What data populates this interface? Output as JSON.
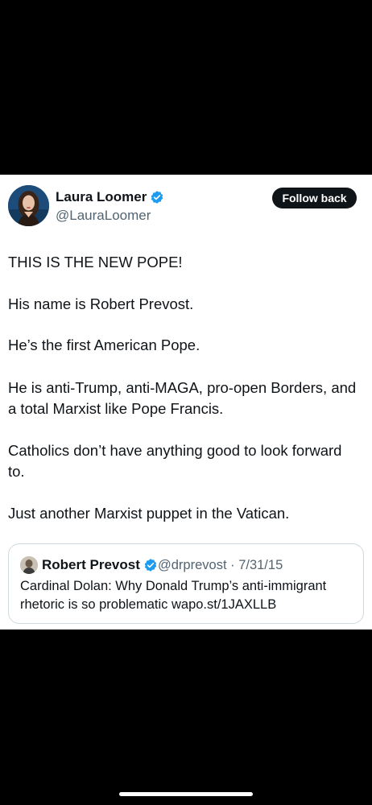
{
  "tweet": {
    "author": {
      "display_name": "Laura Loomer",
      "handle": "@LauraLoomer",
      "verified": true,
      "avatar_icon": "profile-photo"
    },
    "follow_button_label": "Follow back",
    "paragraphs": [
      "THIS IS THE NEW POPE!",
      "His name is Robert Prevost.",
      "He’s the first American Pope.",
      "He is anti-Trump, anti-MAGA, pro-open Borders, and a total Marxist like Pope Francis.",
      "Catholics don’t have anything good to look forward to.",
      "Just another Marxist puppet in the Vatican."
    ],
    "quoted_tweet": {
      "display_name": "Robert Prevost",
      "verified": true,
      "handle_date": "@drprevost · 7/31/15",
      "text": "Cardinal Dolan: Why Donald Trump’s anti-immigrant rhetoric is so problematic wapo.st/1JAXLLB"
    }
  },
  "colors": {
    "background": "#000000",
    "card": "#ffffff",
    "text_primary": "#0f1419",
    "text_secondary": "#536471",
    "verified_blue": "#1d9bf0",
    "border": "#cfd9de"
  }
}
